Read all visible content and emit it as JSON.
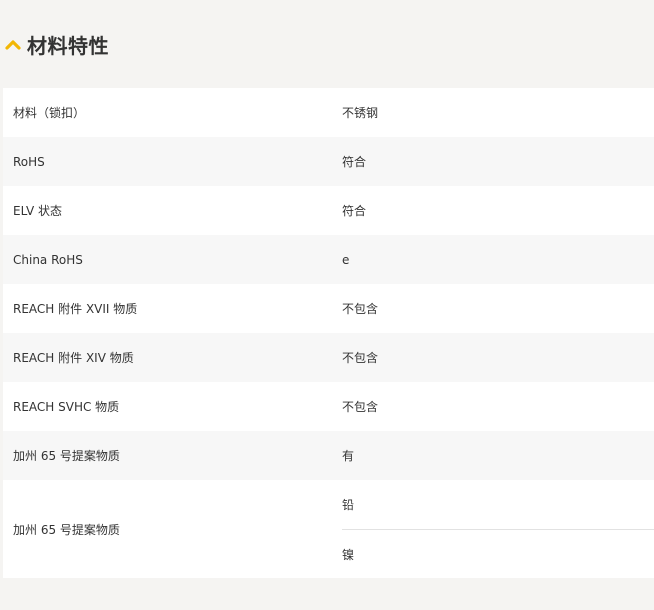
{
  "section": {
    "title": "材料特性",
    "icon": "chevron-up-icon",
    "accent_color": "#f2b705"
  },
  "rows": [
    {
      "label": "材料（锁扣）",
      "value": "不锈钢"
    },
    {
      "label": "RoHS",
      "value": "符合"
    },
    {
      "label": "ELV 状态",
      "value": "符合"
    },
    {
      "label": "China RoHS",
      "value": "e"
    },
    {
      "label": "REACH 附件 XVII 物质",
      "value": "不包含"
    },
    {
      "label": "REACH 附件 XIV 物质",
      "value": "不包含"
    },
    {
      "label": "REACH SVHC 物质",
      "value": "不包含"
    },
    {
      "label": "加州 65 号提案物质",
      "value": "有"
    }
  ],
  "multi_row": {
    "label": "加州 65 号提案物质",
    "values": [
      "铅",
      "镍"
    ]
  }
}
